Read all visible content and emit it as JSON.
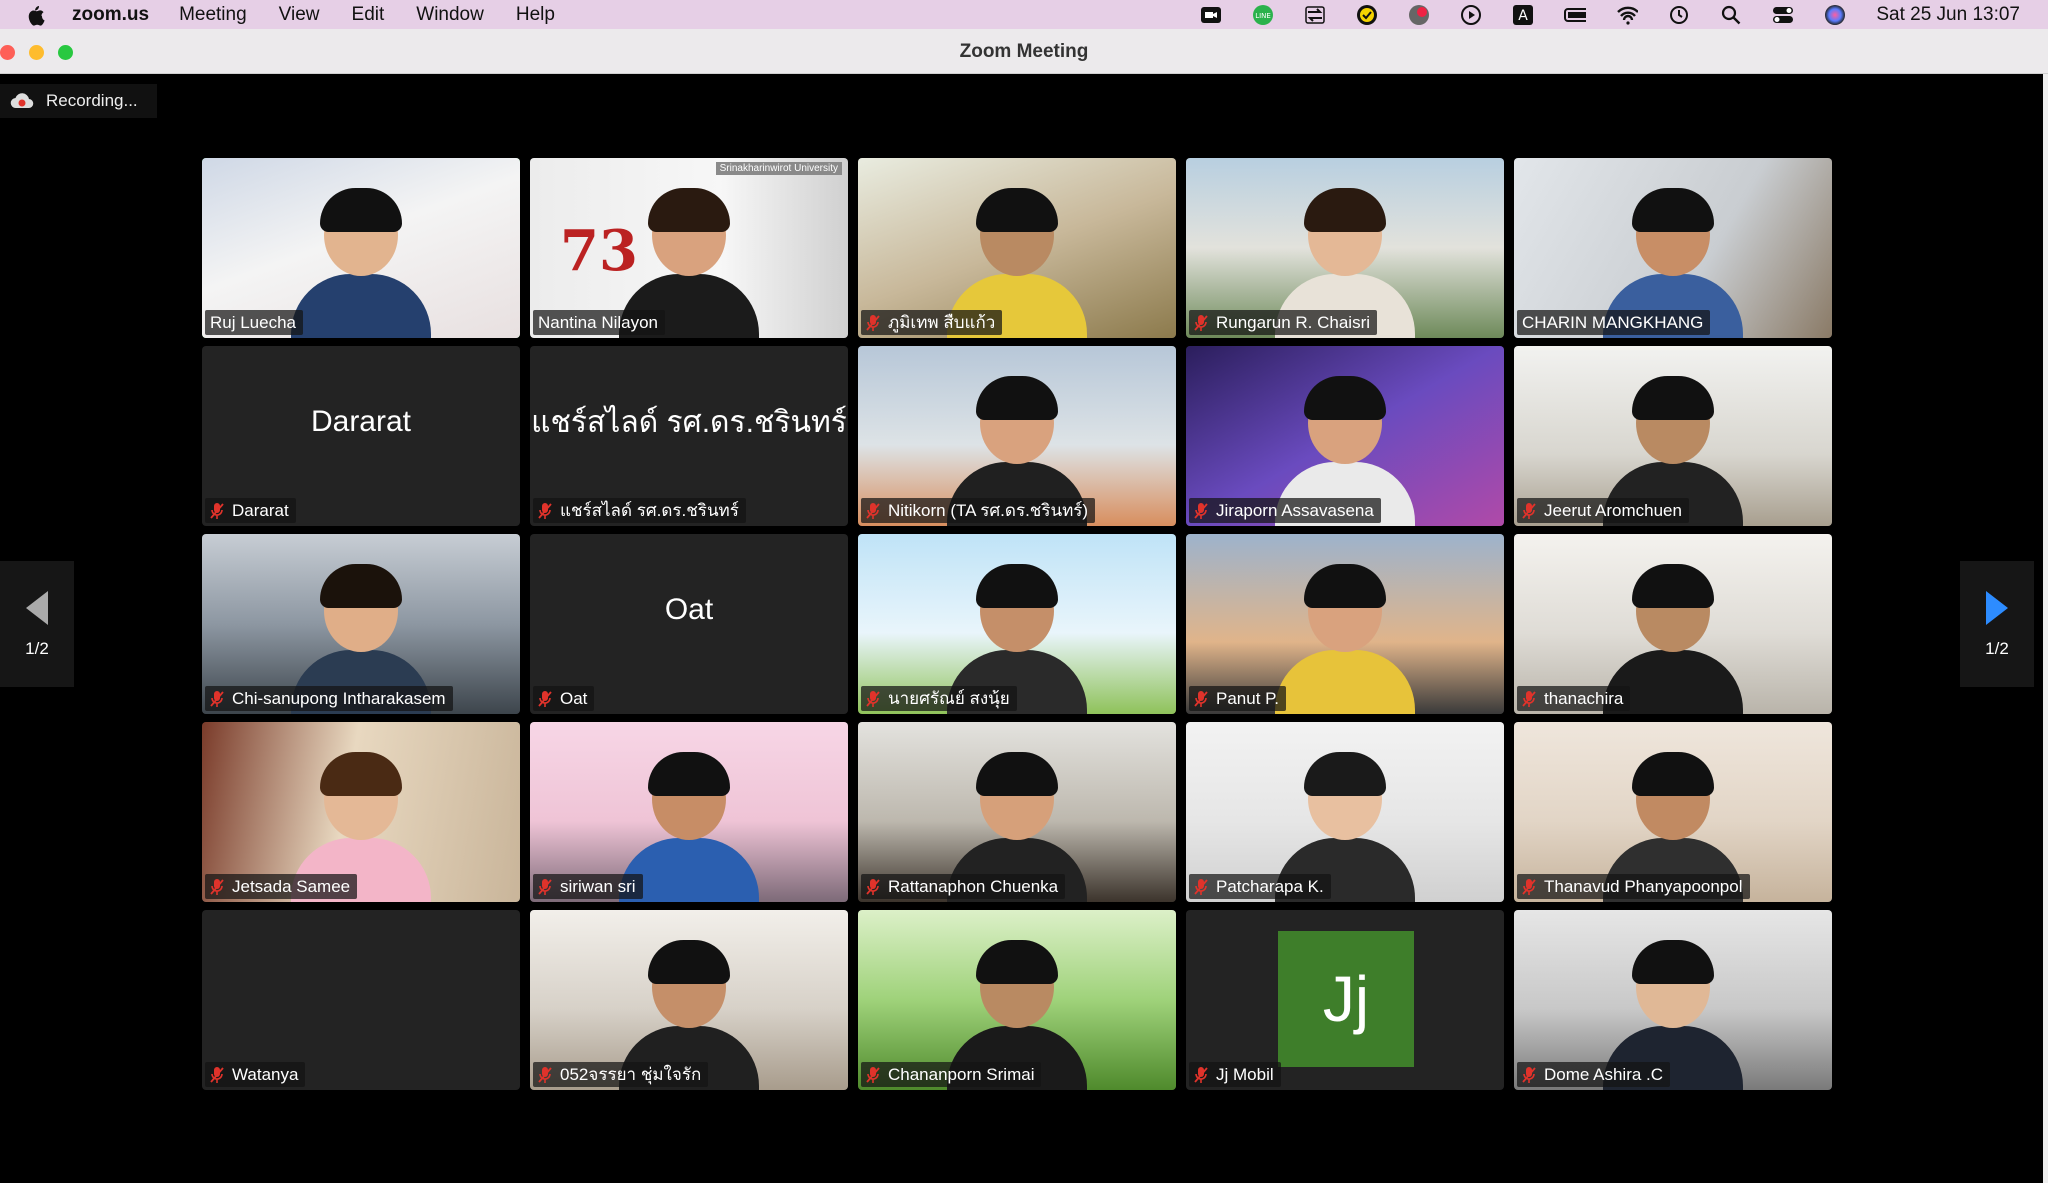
{
  "menubar": {
    "app_name": "zoom.us",
    "menus": [
      "Meeting",
      "View",
      "Edit",
      "Window",
      "Help"
    ],
    "clock": "Sat 25 Jun  13:07"
  },
  "window": {
    "title": "Zoom Meeting"
  },
  "recording": {
    "label": "Recording..."
  },
  "pager": {
    "left_label": "1/2",
    "right_label": "1/2"
  },
  "colors": {
    "active_border": "#4fd46a",
    "nav_arrow_right": "#2d8cff",
    "avatar_jj": "#3e7e2a"
  },
  "participants": [
    {
      "name": "Ruj Luecha",
      "muted": false,
      "video": true,
      "active": true
    },
    {
      "name": "Nantina Nilayon",
      "muted": false,
      "video": true,
      "banner": "Srinakharinwirot University",
      "badge": "73"
    },
    {
      "name": "ภูมิเทพ สืบแก้ว",
      "muted": true,
      "video": true
    },
    {
      "name": "Rungarun R. Chaisri",
      "muted": true,
      "video": true
    },
    {
      "name": "CHARIN MANGKHANG",
      "muted": false,
      "video": true
    },
    {
      "name": "Dararat",
      "muted": true,
      "video": false,
      "display": "Dararat"
    },
    {
      "name": "แชร์สไลด์ รศ.ดร.ชรินทร์",
      "muted": true,
      "video": false,
      "display": "แชร์สไลด์ รศ.ดร.ชรินทร์"
    },
    {
      "name": "Nitikorn (TA รศ.ดร.ชรินทร์)",
      "muted": true,
      "video": true
    },
    {
      "name": "Jiraporn Assavasena",
      "muted": true,
      "video": true
    },
    {
      "name": "Jeerut Aromchuen",
      "muted": true,
      "video": true
    },
    {
      "name": "Chi-sanupong Intharakasem",
      "muted": true,
      "video": true
    },
    {
      "name": "Oat",
      "muted": true,
      "video": false,
      "display": "Oat"
    },
    {
      "name": "นายศรัณย์ สงนุ้ย",
      "muted": true,
      "video": true
    },
    {
      "name": "Panut P.",
      "muted": true,
      "video": true
    },
    {
      "name": "thanachira",
      "muted": true,
      "video": true
    },
    {
      "name": "Jetsada Samee",
      "muted": true,
      "video": true
    },
    {
      "name": "siriwan sri",
      "muted": true,
      "video": true
    },
    {
      "name": "Rattanaphon Chuenka",
      "muted": true,
      "video": true
    },
    {
      "name": "Patcharapa K.",
      "muted": true,
      "video": true
    },
    {
      "name": "Thanavud Phanyapoonpol",
      "muted": true,
      "video": true
    },
    {
      "name": "Watanya",
      "muted": true,
      "video": false,
      "display": ""
    },
    {
      "name": "052จรรยา ชุ่มใจรัก",
      "muted": true,
      "video": true
    },
    {
      "name": "Chananporn Srimai",
      "muted": true,
      "video": true
    },
    {
      "name": "Jj Mobil",
      "muted": true,
      "video": false,
      "avatar": "Jj"
    },
    {
      "name": "Dome Ashira .C",
      "muted": true,
      "video": true
    }
  ]
}
